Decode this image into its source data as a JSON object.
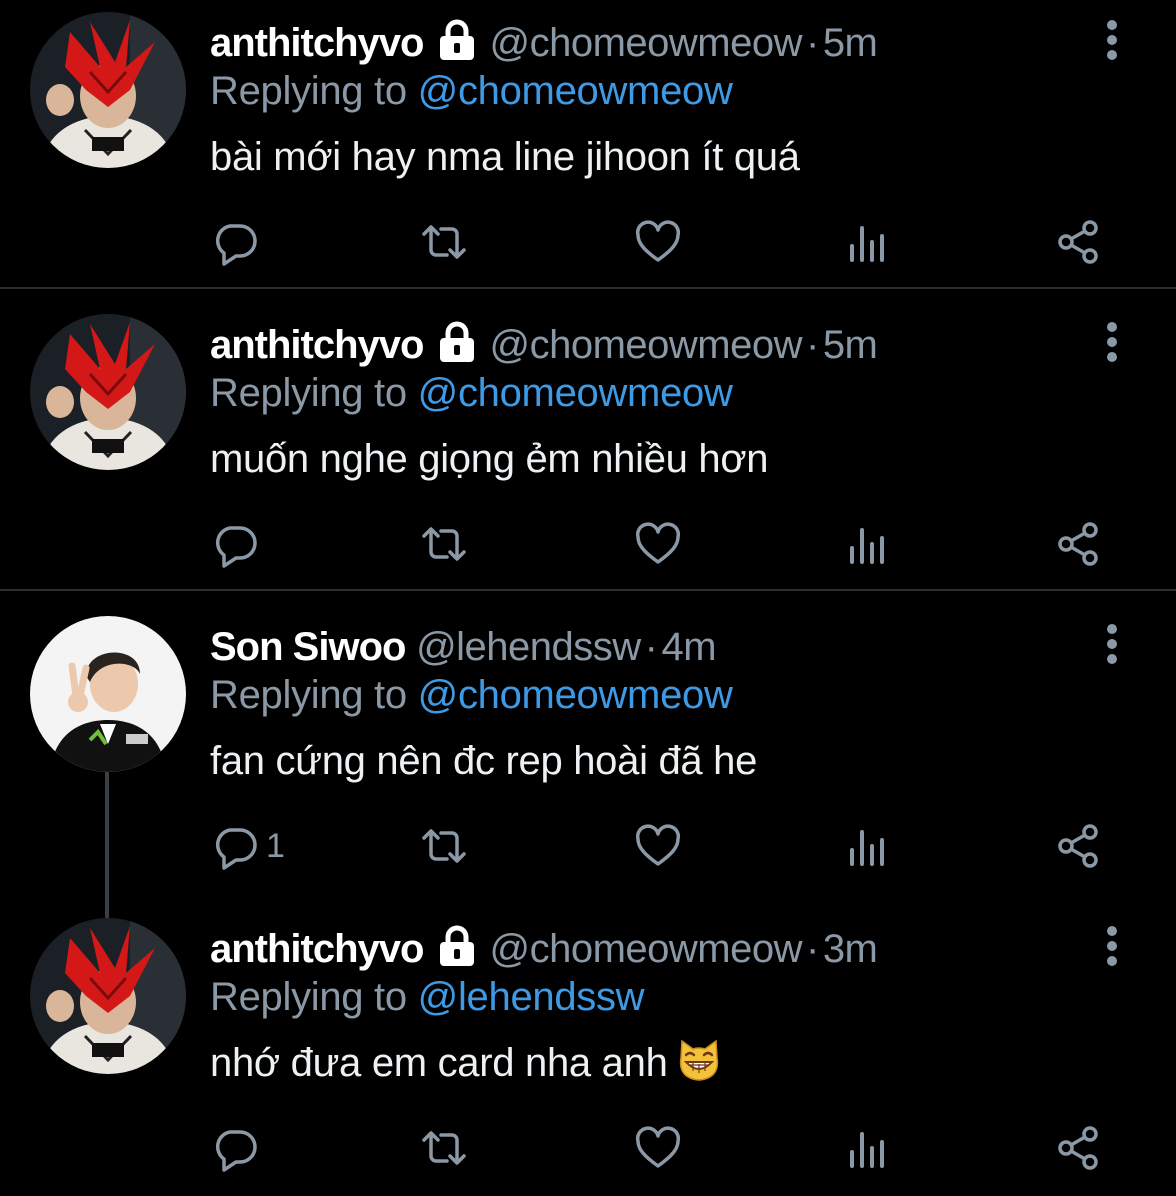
{
  "tweets": [
    {
      "name": "anthitchyvo",
      "protected": true,
      "handle": "@chomeowmeow",
      "dot": "·",
      "time": "5m",
      "replying_prefix": "Replying to",
      "replying_to": "@chomeowmeow",
      "text": "bài mới hay nma line jihoon ít quá",
      "reply_count": "",
      "avatar": "red-mask-avatar"
    },
    {
      "name": "anthitchyvo",
      "protected": true,
      "handle": "@chomeowmeow",
      "dot": "·",
      "time": "5m",
      "replying_prefix": "Replying to",
      "replying_to": "@chomeowmeow",
      "text": "muốn nghe giọng ẻm nhiều hơn",
      "reply_count": "",
      "avatar": "red-mask-avatar"
    },
    {
      "name": "Son Siwoo",
      "protected": false,
      "handle": "@lehendssw",
      "dot": "·",
      "time": "4m",
      "replying_prefix": "Replying to",
      "replying_to": "@chomeowmeow",
      "text": "fan cứng nên đc rep hoài đã he",
      "reply_count": "1",
      "avatar": "peace-sign-avatar"
    },
    {
      "name": "anthitchyvo",
      "protected": true,
      "handle": "@chomeowmeow",
      "dot": "·",
      "time": "3m",
      "replying_prefix": "Replying to",
      "replying_to": "@lehendssw",
      "text": "nhớ đưa em card nha anh",
      "emoji": "grinning-cat-emoji",
      "reply_count": "",
      "avatar": "red-mask-avatar"
    }
  ],
  "icons": {
    "reply": "reply-icon",
    "retweet": "retweet-icon",
    "like": "like-icon",
    "views": "views-icon",
    "share": "share-icon",
    "more": "more-icon",
    "lock": "lock-icon"
  },
  "colors": {
    "background": "#000000",
    "name": "#ffffff",
    "secondary": "#8b98a5",
    "link": "#3f9ae6",
    "divider": "#2b2f33"
  }
}
